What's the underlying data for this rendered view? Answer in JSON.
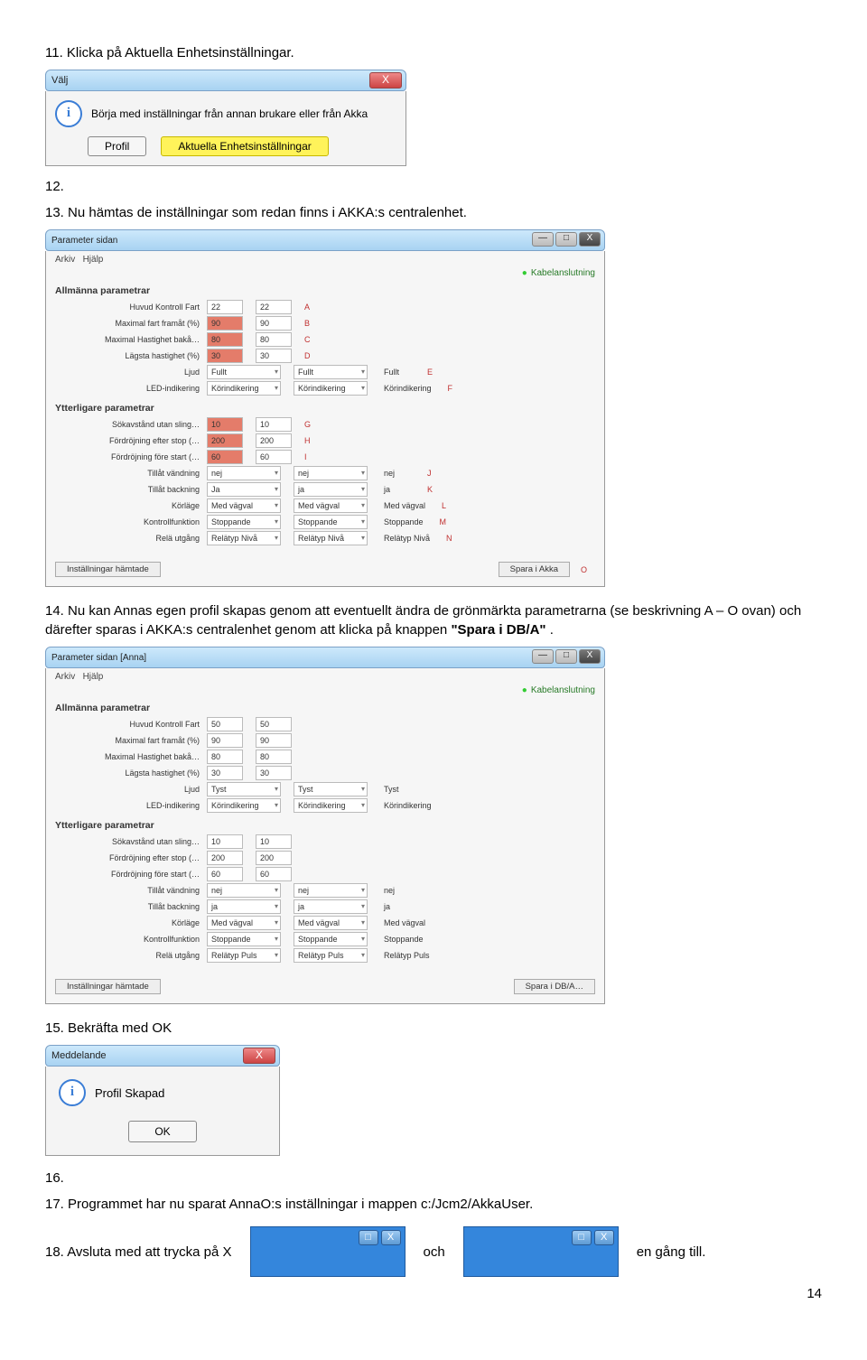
{
  "steps": {
    "s11": "11. Klicka på Aktuella Enhetsinställningar.",
    "s12": "12.",
    "s13": "13. Nu hämtas de inställningar som redan finns i AKKA:s centralenhet.",
    "s14_pre": "14. Nu kan Annas egen profil skapas genom att eventuellt ändra de grönmärkta parametrarna (se beskrivning A – O ovan) och därefter sparas i AKKA:s centralenhet genom att klicka på knappen ",
    "s14_bold": "\"Spara i DB/A\"",
    "s14_post": ".",
    "s15": "15. Bekräfta med OK",
    "s16": "16.",
    "s17": "17. Programmet har nu sparat AnnaO:s inställningar i mappen c:/Jcm2/AkkaUser.",
    "s18_pre": "18. Avsluta med att trycka på X",
    "s18_mid": "och",
    "s18_post": "en gång till."
  },
  "page_num": "14",
  "dlg1": {
    "title": "Välj",
    "close": "X",
    "message": "Börja med inställningar från annan brukare eller från Akka",
    "btn_profil": "Profil",
    "btn_aktuella": "Aktuella Enhetsinställningar"
  },
  "win": {
    "title1": "Parameter sidan",
    "title2": "Parameter sidan [Anna]",
    "menu_arkiv": "Arkiv",
    "menu_hjalp": "Hjälp",
    "status": "Kabelanslutning",
    "sec_allm": "Allmänna parametrar",
    "sec_ytt": "Ytterligare parametrar",
    "p_huvud": "Huvud Kontroll Fart",
    "p_maxf": "Maximal fart framåt (%)",
    "p_maxb": "Maximal Hastighet bakå…",
    "p_lag": "Lägsta hastighet (%)",
    "p_ljud": "Ljud",
    "p_led": "LED-indikering",
    "p_sok": "Sökavstånd utan sling…",
    "p_fefter": "Fördröjning efter stop (…",
    "p_ffore": "Fördröjning före start (…",
    "p_vand": "Tillåt vändning",
    "p_back": "Tillåt backning",
    "p_korl": "Körläge",
    "p_kontr": "Kontrollfunktion",
    "p_rela": "Relä utgång",
    "footer_left": "Inställningar hämtade",
    "footer_btn1": "Spara i Akka",
    "footer_btn2": "Spara i DB/A…",
    "v1": {
      "huvud_a": "22",
      "huvud_b": "22",
      "maxf_a": "90",
      "maxf_b": "90",
      "maxb_a": "80",
      "maxb_b": "80",
      "lag_a": "30",
      "lag_b": "30",
      "ljud_a": "Fullt",
      "ljud_b": "Fullt",
      "ljud_c": "Fullt",
      "led_a": "Körindikering",
      "led_b": "Körindikering",
      "led_c": "Körindikering",
      "sok_a": "10",
      "sok_b": "10",
      "fefter_a": "200",
      "fefter_b": "200",
      "ffore_a": "60",
      "ffore_b": "60",
      "vand_a": "nej",
      "vand_b": "nej",
      "vand_c": "nej",
      "back_a": "Ja",
      "back_b": "ja",
      "back_c": "ja",
      "korl_a": "Med vägval",
      "korl_b": "Med vägval",
      "korl_c": "Med vägval",
      "kontr_a": "Stoppande",
      "kontr_b": "Stoppande",
      "kontr_c": "Stoppande",
      "rela_a": "Relätyp Nivå",
      "rela_b": "Relätyp Nivå",
      "rela_c": "Relätyp Nivå"
    },
    "v2": {
      "huvud_a": "50",
      "huvud_b": "50",
      "maxf_a": "90",
      "maxf_b": "90",
      "maxb_a": "80",
      "maxb_b": "80",
      "lag_a": "30",
      "lag_b": "30",
      "ljud_a": "Tyst",
      "ljud_b": "Tyst",
      "ljud_c": "Tyst",
      "led_a": "Körindikering",
      "led_b": "Körindikering",
      "led_c": "Körindikering",
      "sok_a": "10",
      "sok_b": "10",
      "fefter_a": "200",
      "fefter_b": "200",
      "ffore_a": "60",
      "ffore_b": "60",
      "vand_a": "nej",
      "vand_b": "nej",
      "vand_c": "nej",
      "back_a": "ja",
      "back_b": "ja",
      "back_c": "ja",
      "korl_a": "Med vägval",
      "korl_b": "Med vägval",
      "korl_c": "Med vägval",
      "kontr_a": "Stoppande",
      "kontr_b": "Stoppande",
      "kontr_c": "Stoppande",
      "rela_a": "Relätyp Puls",
      "rela_b": "Relätyp Puls",
      "rela_c": "Relätyp Puls"
    },
    "ann": {
      "A": "A",
      "B": "B",
      "C": "C",
      "D": "D",
      "E": "E",
      "F": "F",
      "G": "G",
      "H": "H",
      "I": "I",
      "J": "J",
      "K": "K",
      "L": "L",
      "M": "M",
      "N": "N",
      "O": "O"
    }
  },
  "msg": {
    "title": "Meddelande",
    "text": "Profil Skapad",
    "ok": "OK",
    "close": "X"
  }
}
